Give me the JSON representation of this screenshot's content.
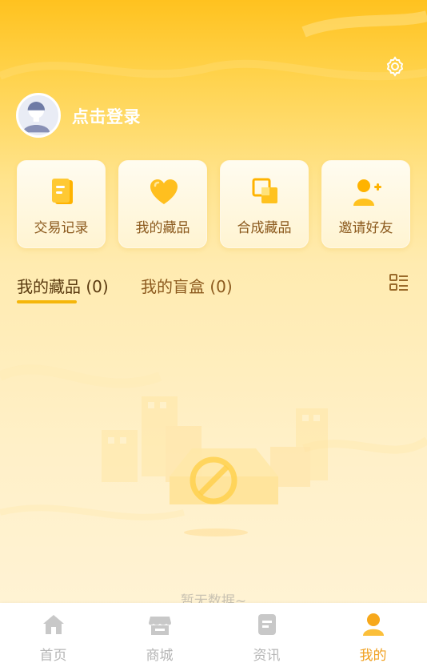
{
  "header": {
    "settings_icon": "gear-icon",
    "avatar_icon": "default-user-avatar",
    "login_label": "点击登录"
  },
  "quick_actions": [
    {
      "label": "交易记录",
      "icon": "ledger-icon"
    },
    {
      "label": "我的藏品",
      "icon": "heart-icon"
    },
    {
      "label": "合成藏品",
      "icon": "merge-icon"
    },
    {
      "label": "邀请好友",
      "icon": "add-user-icon"
    }
  ],
  "tabs": {
    "items": [
      {
        "label": "我的藏品 (0)",
        "active": true
      },
      {
        "label": "我的盲盒 (0)",
        "active": false
      }
    ],
    "view_toggle_icon": "list-view-icon"
  },
  "empty_state": {
    "text": "暂无数据~",
    "icon": "empty-box-illustration"
  },
  "tabbar": {
    "items": [
      {
        "label": "首页",
        "icon": "home-icon",
        "active": false
      },
      {
        "label": "商城",
        "icon": "store-icon",
        "active": false
      },
      {
        "label": "资讯",
        "icon": "news-icon",
        "active": false
      },
      {
        "label": "我的",
        "icon": "profile-icon",
        "active": true
      }
    ]
  },
  "colors": {
    "brand_yellow": "#FFC21F",
    "accent_orange": "#F0A020",
    "label_brown": "#8C5A1E",
    "inactive_gray": "#B5B5B5"
  }
}
